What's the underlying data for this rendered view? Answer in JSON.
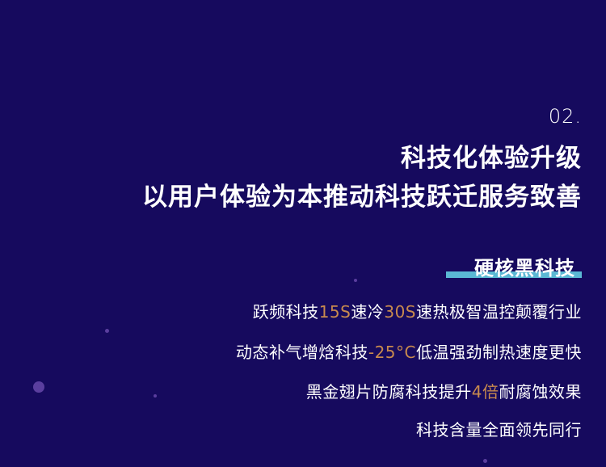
{
  "section_number": "02.",
  "headline": {
    "line1": "科技化体验升级",
    "line2": "以用户体验为本推动科技跃迁服务致善"
  },
  "subheading": "硬核黑科技",
  "features": [
    {
      "pre": "跃频科技",
      "hl1": "15S",
      "mid": "速冷",
      "hl2": "30S",
      "post": "速热极智温控颠覆行业"
    },
    {
      "pre": "动态补气增焓科技",
      "hl1": "-25°C",
      "mid": "",
      "hl2": "",
      "post": "低温强劲制热速度更快"
    },
    {
      "pre": "黑金翅片防腐科技提升",
      "hl1": "4倍",
      "mid": "",
      "hl2": "",
      "post": "耐腐蚀效果"
    },
    {
      "pre": "科技含量全面领先同行",
      "hl1": "",
      "mid": "",
      "hl2": "",
      "post": ""
    }
  ],
  "colors": {
    "background": "#160a5e",
    "highlight_text": "#c88a4e",
    "underline_bar": "#5bb8d4",
    "decor_dot": "#5a3e9e"
  }
}
